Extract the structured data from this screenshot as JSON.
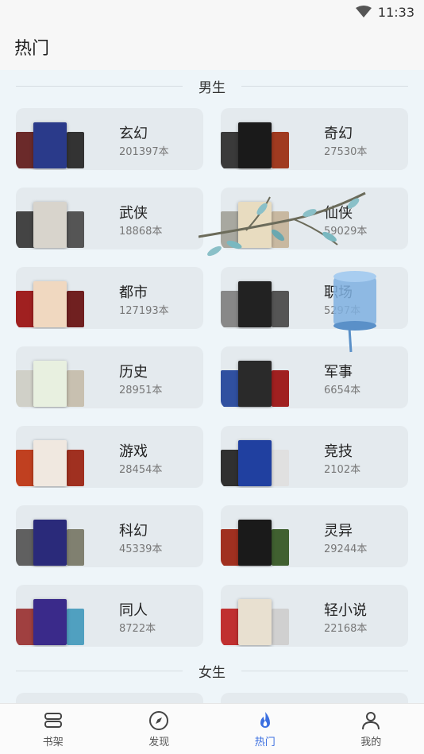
{
  "status": {
    "time": "11:33"
  },
  "header": {
    "title": "热门"
  },
  "sections": [
    {
      "title": "男生",
      "items": [
        {
          "name": "玄幻",
          "count": "201397本",
          "colors": [
            "#6b2a2a",
            "#2a3a8a",
            "#333333"
          ]
        },
        {
          "name": "奇幻",
          "count": "27530本",
          "colors": [
            "#3a3a3a",
            "#1a1a1a",
            "#a03a20"
          ]
        },
        {
          "name": "武侠",
          "count": "18868本",
          "colors": [
            "#444444",
            "#d8d4cc",
            "#555555"
          ]
        },
        {
          "name": "仙侠",
          "count": "59029本",
          "colors": [
            "#a8a8a0",
            "#e8dcc0",
            "#c8b8a0"
          ]
        },
        {
          "name": "都市",
          "count": "127193本",
          "colors": [
            "#a02020",
            "#f0d8c0",
            "#702020"
          ]
        },
        {
          "name": "职场",
          "count": "5297本",
          "colors": [
            "#888888",
            "#222222",
            "#555555"
          ]
        },
        {
          "name": "历史",
          "count": "28951本",
          "colors": [
            "#d0d0c8",
            "#e8f0e0",
            "#c8c0b0"
          ]
        },
        {
          "name": "军事",
          "count": "6654本",
          "colors": [
            "#3050a0",
            "#2a2a2a",
            "#a02020"
          ]
        },
        {
          "name": "游戏",
          "count": "28454本",
          "colors": [
            "#c04020",
            "#f0e8e0",
            "#a03020"
          ]
        },
        {
          "name": "竞技",
          "count": "2102本",
          "colors": [
            "#303030",
            "#2040a0",
            "#e0e0e0"
          ]
        },
        {
          "name": "科幻",
          "count": "45339本",
          "colors": [
            "#606060",
            "#2a2a7a",
            "#808070"
          ]
        },
        {
          "name": "灵异",
          "count": "29244本",
          "colors": [
            "#a03020",
            "#1a1a1a",
            "#406030"
          ]
        },
        {
          "name": "同人",
          "count": "8722本",
          "colors": [
            "#a04040",
            "#3a2a8a",
            "#50a0c0"
          ]
        },
        {
          "name": "轻小说",
          "count": "22168本",
          "colors": [
            "#c03030",
            "#e8e0d0",
            "#d0d0d0"
          ]
        }
      ]
    },
    {
      "title": "女生",
      "items": [
        {
          "name": "",
          "count": "",
          "colors": [
            "#e4eaee",
            "#e4eaee",
            "#e4eaee"
          ]
        },
        {
          "name": "",
          "count": "",
          "colors": [
            "#e4eaee",
            "#e4eaee",
            "#e4eaee"
          ]
        }
      ]
    }
  ],
  "nav": [
    {
      "label": "书架",
      "icon": "bookshelf-icon"
    },
    {
      "label": "发现",
      "icon": "compass-icon"
    },
    {
      "label": "热门",
      "icon": "flame-icon",
      "active": true
    },
    {
      "label": "我的",
      "icon": "person-icon"
    }
  ],
  "colors": {
    "accent": "#3b6fe0",
    "card_bg": "#e4eaee",
    "content_bg": "#eef5f9"
  }
}
